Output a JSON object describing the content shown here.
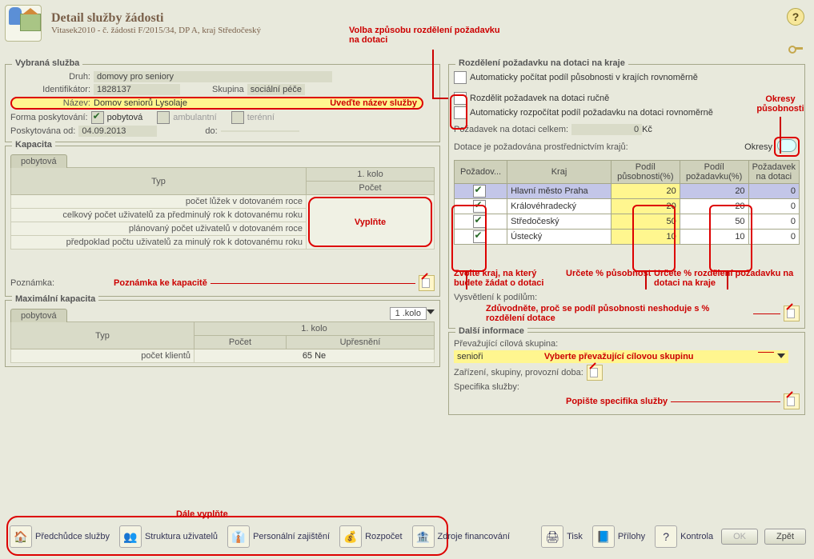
{
  "header": {
    "title": "Detail služby žádosti",
    "subtitle": "Vitasek2010 - č. žádosti F/2015/34, DP A, kraj Středočeský"
  },
  "vybrana": {
    "legend": "Vybraná služba",
    "druh_l": "Druh:",
    "druh": "domovy pro seniory",
    "id_l": "Identifikátor:",
    "id": "1828137",
    "skup_l": "Skupina",
    "skup": "sociální péče",
    "nazev_l": "Název:",
    "nazev": "Domov seniorů Lysolaje",
    "nazev_hint": "Uveďte název služby",
    "forma_l": "Forma poskytování:",
    "f1": "pobytová",
    "f2": "ambulantní",
    "f3": "terénní",
    "od_l": "Poskytována od:",
    "od": "04.09.2013",
    "do_l": "do:"
  },
  "kap": {
    "legend": "Kapacita",
    "tab": "pobytová",
    "col_typ": "Typ",
    "col_kolo": "1. kolo",
    "col_pocet": "Počet",
    "rows": [
      "počet lůžek v dotovaném roce",
      "celkový počet uživatelů za předminulý rok k dotovanému roku",
      "plánovaný počet uživatelů v dotovaném roce",
      "předpoklad počtu uživatelů za minulý rok k dotovanému roku"
    ],
    "vypln": "Vyplňte",
    "pozn_l": "Poznámka:",
    "pozn_hint": "Poznámka ke kapacitě"
  },
  "max": {
    "legend": "Maximální kapacita",
    "tab": "pobytová",
    "kolo_sel": "1 .kolo",
    "col_typ": "Typ",
    "col_kolo": "1. kolo",
    "col_pocet": "Počet",
    "col_upr": "Upřesnění",
    "row": "počet klientů",
    "row_val": "65 Ne"
  },
  "rozd": {
    "legend": "Rozdělení požadavku na dotaci na kraje",
    "c1": "Automaticky počítat podíl působnosti v krajích rovnoměrně",
    "c2": "Rozdělit požadavek na dotaci ručně",
    "c3": "Automaticky rozpočítat podíl požadavku na dotaci rovnoměrně",
    "poz_l": "Požadavek na dotaci celkem:",
    "poz_v": "0",
    "kc": "Kč",
    "dot_l": "Dotace je požadována prostřednictvím krajů:",
    "okresy_l": "Okresy",
    "th": [
      "Požadov...",
      "Kraj",
      "Podíl působnosti(%)",
      "Podíl požadavku(%)",
      "Požadavek na dotaci"
    ],
    "rows": [
      {
        "k": "Hlavní město Praha",
        "pp": 20,
        "pr": 20,
        "d": 0,
        "sel": true
      },
      {
        "k": "Královéhradecký",
        "pp": 20,
        "pr": 20,
        "d": 0
      },
      {
        "k": "Středočeský",
        "pp": 50,
        "pr": 50,
        "d": 0
      },
      {
        "k": "Ústecký",
        "pp": 10,
        "pr": 10,
        "d": 0
      }
    ],
    "vys_l": "Vysvětlení k podílům:"
  },
  "dalsi": {
    "legend": "Další informace",
    "prev_l": "Převažující cílová skupina:",
    "prev_v": "senioři",
    "prev_hint": "Vyberte převažující cílovou skupinu",
    "zar_l": "Zařízení, skupiny, provozní doba:",
    "spec_l": "Specifika služby:",
    "spec_hint": "Popište specifika služby"
  },
  "hints": {
    "top": "Volba způsobu rozdělení požadavku na dotaci",
    "okresy": "Okresy působnosti",
    "zvolte": "Zvolte kraj, na který budete žádat o dotaci",
    "urcete1": "Určete % působnost",
    "urcete2": "Určete % rozdělení požadavku na dotaci na kraje",
    "zduv": "Zdůvodněte, proč se podíl působnosti neshoduje s % rozdělení dotace",
    "dale": "Dále vyplňte"
  },
  "bottom": {
    "b1": "Předchůdce služby",
    "b2": "Struktura uživatelů",
    "b3": "Personální zajištění",
    "b4": "Rozpočet",
    "b5": "Zdroje financování",
    "tisk": "Tisk",
    "pril": "Přílohy",
    "kont": "Kontrola",
    "ok": "OK",
    "zpet": "Zpět"
  }
}
